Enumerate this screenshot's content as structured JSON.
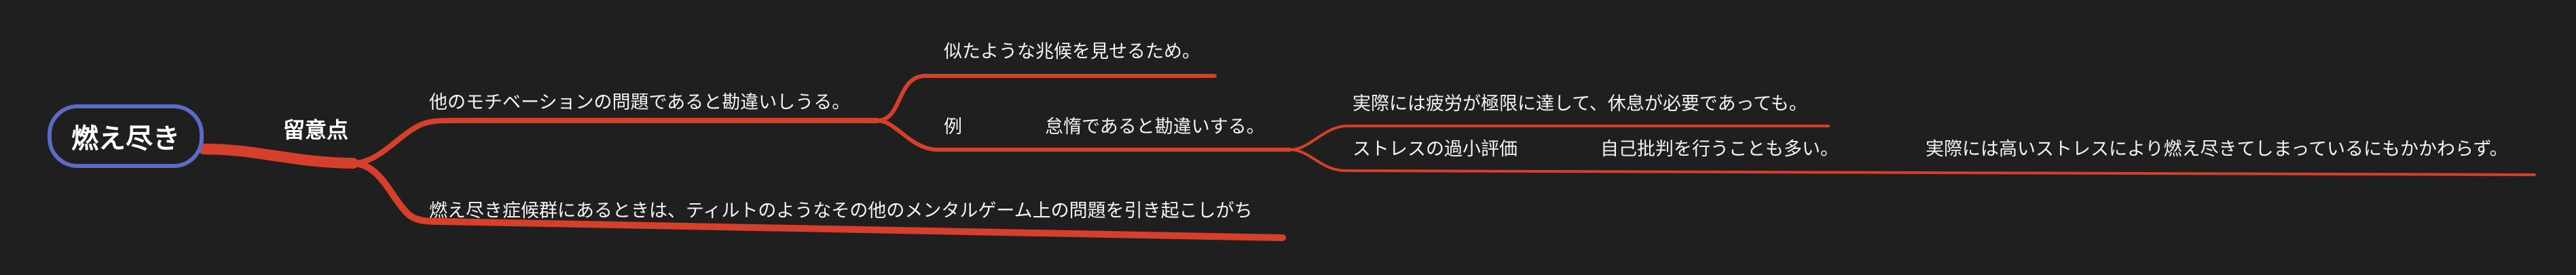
{
  "mindmap": {
    "root": {
      "label": "燃え尽き"
    },
    "level1": {
      "label": "留意点"
    },
    "branches": {
      "b1": {
        "label": "他のモチベーションの問題であると勘違いしうる。"
      },
      "b1_1": {
        "label": "似たような兆候を見せるため。"
      },
      "b1_2": {
        "label": "例"
      },
      "b1_2_1": {
        "label": "怠惰であると勘違いする。"
      },
      "b1_2_1_1": {
        "label": "実際には疲労が極限に達して、休息が必要であっても。"
      },
      "b1_2_1_2": {
        "label": "ストレスの過小評価"
      },
      "b1_2_1_2_1": {
        "label": "自己批判を行うことも多い。"
      },
      "b1_2_1_2_1_1": {
        "label": "実際には高いストレスにより燃え尽きてしまっているにもかかわらず。"
      },
      "b2": {
        "label": "燃え尽き症候群にあるときは、ティルトのようなその他のメンタルゲーム上の問題を引き起こしがち"
      }
    },
    "colors": {
      "background": "#1f1f1f",
      "branch": "#d6402b",
      "root_border": "#5b6bc6",
      "text": "#f2f2f2"
    }
  }
}
